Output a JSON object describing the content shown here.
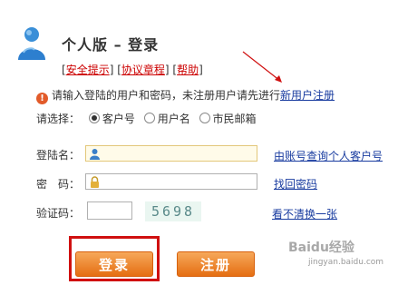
{
  "header": {
    "title": "个人版 – 登录",
    "links": [
      "安全提示",
      "协议章程",
      "帮助"
    ]
  },
  "alert": {
    "text": "请输入登陆的用户和密码，未注册用户请先进行",
    "link": "新用户注册"
  },
  "login_type": {
    "label": "请选择：",
    "options": [
      "客户号",
      "用户名",
      "市民邮箱"
    ],
    "selected": "客户号"
  },
  "form": {
    "username_label": "登陆名：",
    "username_link": "由账号查询个人客户号",
    "password_label": "密　码：",
    "password_link": "找回密码",
    "captcha_label": "验证码：",
    "captcha_text": "5698",
    "captcha_link": "看不清换一张"
  },
  "buttons": {
    "login": "登录",
    "register": "注册"
  },
  "watermark": {
    "text": "Baidu经验",
    "sub": "jingyan.baidu.com"
  },
  "colors": {
    "accent": "#e56e12",
    "link": "#1a3da0",
    "highlight": "#d01010"
  }
}
